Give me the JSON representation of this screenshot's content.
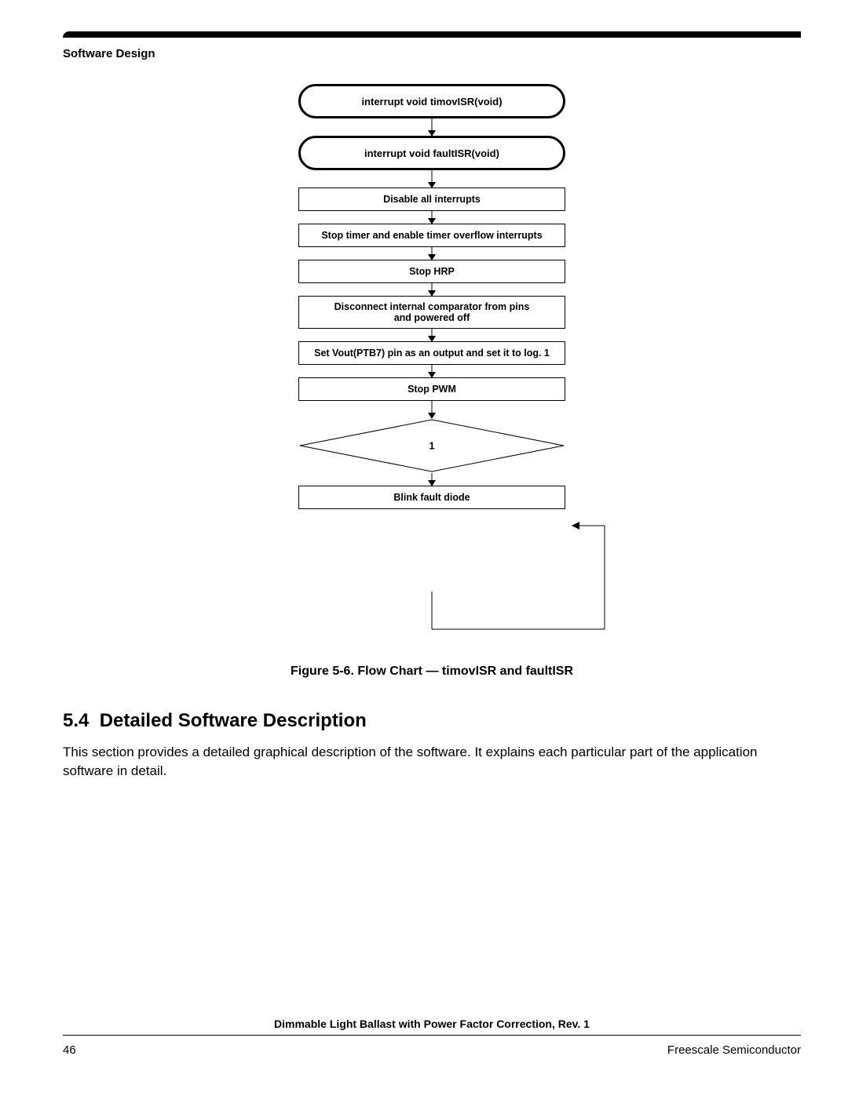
{
  "header": {
    "section": "Software Design"
  },
  "flowchart": {
    "terminal1": "interrupt void timovISR(void)",
    "terminal2": "interrupt void faultISR(void)",
    "step1": "Disable all interrupts",
    "step2": "Stop timer and enable timer overflow interrupts",
    "step3": "Stop HRP",
    "step4_line1": "Disconnect internal comparator from pins",
    "step4_line2": "and powered off",
    "step5": "Set Vout(PTB7) pin as an output and set it to log. 1",
    "step6": "Stop PWM",
    "decision": "1",
    "step7": "Blink fault diode"
  },
  "caption": "Figure 5-6. Flow Chart — timovISR and faultISR",
  "section": {
    "number": "5.4",
    "title": "Detailed Software Description",
    "body": "This section provides a detailed graphical description of the software. It explains each particular part of the application software in detail."
  },
  "footer": {
    "doc_title": "Dimmable Light Ballast with Power Factor Correction, Rev. 1",
    "page_number": "46",
    "company": "Freescale Semiconductor"
  }
}
